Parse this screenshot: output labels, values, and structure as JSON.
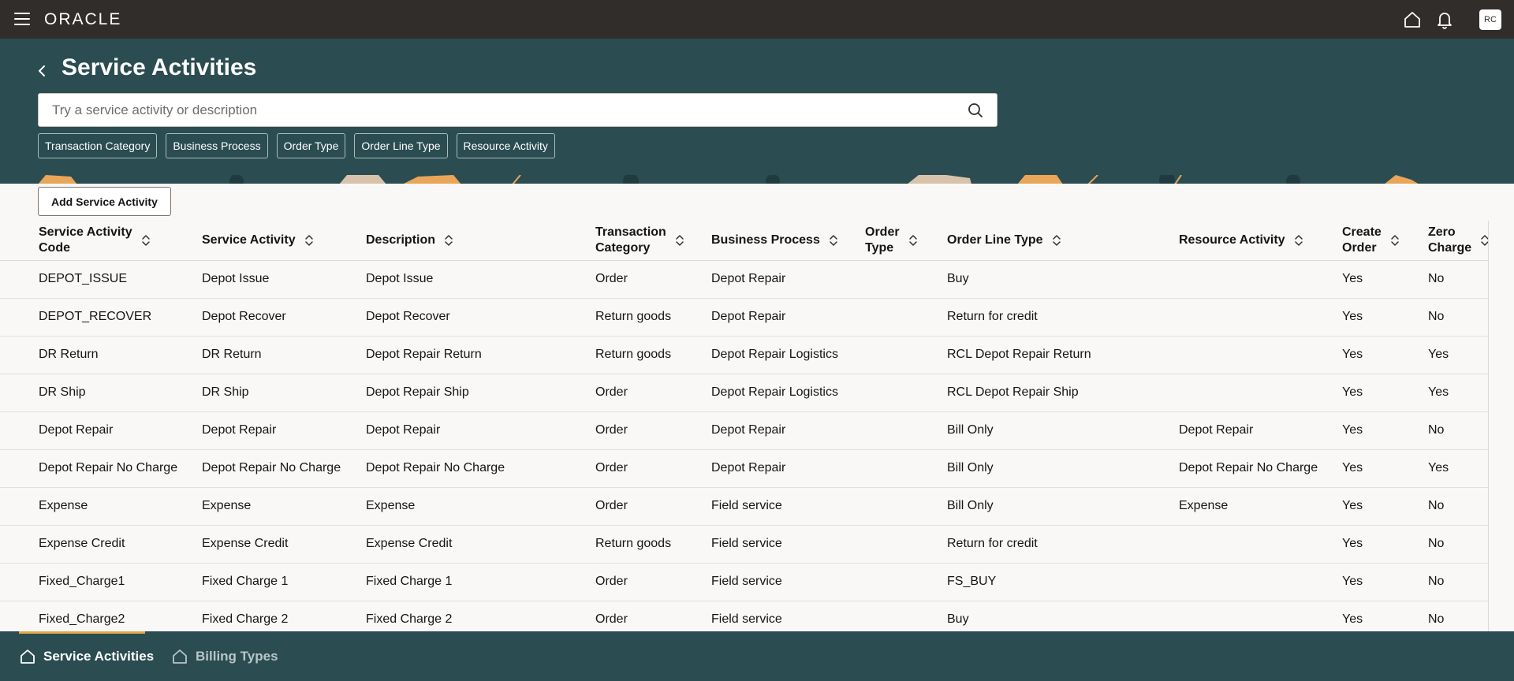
{
  "app": {
    "logo": "ORACLE",
    "avatar_initials": "RC"
  },
  "page": {
    "title": "Service Activities"
  },
  "search": {
    "placeholder": "Try a service activity or description"
  },
  "filters": [
    "Transaction Category",
    "Business Process",
    "Order Type",
    "Order Line Type",
    "Resource Activity"
  ],
  "toolbar": {
    "add_label": "Add Service Activity"
  },
  "table": {
    "columns": [
      [
        "Service Activity",
        "Code"
      ],
      [
        "Service Activity"
      ],
      [
        "Description"
      ],
      [
        "Transaction",
        "Category"
      ],
      [
        "Business Process"
      ],
      [
        "Order",
        "Type"
      ],
      [
        "Order Line Type"
      ],
      [
        "Resource Activity"
      ],
      [
        "Create",
        "Order"
      ],
      [
        "Zero",
        "Charge"
      ]
    ],
    "rows": [
      [
        "DEPOT_ISSUE",
        "Depot Issue",
        "Depot Issue",
        "Order",
        "Depot Repair",
        "",
        "Buy",
        "",
        "Yes",
        "No"
      ],
      [
        "DEPOT_RECOVER",
        "Depot Recover",
        "Depot Recover",
        "Return goods",
        "Depot Repair",
        "",
        "Return for credit",
        "",
        "Yes",
        "No"
      ],
      [
        "DR Return",
        "DR Return",
        "Depot Repair Return",
        "Return goods",
        "Depot Repair Logistics",
        "",
        "RCL Depot Repair Return",
        "",
        "Yes",
        "Yes"
      ],
      [
        "DR Ship",
        "DR Ship",
        "Depot Repair Ship",
        "Order",
        "Depot Repair Logistics",
        "",
        "RCL Depot Repair Ship",
        "",
        "Yes",
        "Yes"
      ],
      [
        "Depot Repair",
        "Depot Repair",
        "Depot Repair",
        "Order",
        "Depot Repair",
        "",
        "Bill Only",
        "Depot Repair",
        "Yes",
        "No"
      ],
      [
        "Depot Repair No Charge",
        "Depot Repair No Charge",
        "Depot Repair No Charge",
        "Order",
        "Depot Repair",
        "",
        "Bill Only",
        "Depot Repair No Charge",
        "Yes",
        "Yes"
      ],
      [
        "Expense",
        "Expense",
        "Expense",
        "Order",
        "Field service",
        "",
        "Bill Only",
        "Expense",
        "Yes",
        "No"
      ],
      [
        "Expense Credit",
        "Expense Credit",
        "Expense Credit",
        "Return goods",
        "Field service",
        "",
        "Return for credit",
        "",
        "Yes",
        "No"
      ],
      [
        "Fixed_Charge1",
        "Fixed Charge 1",
        "Fixed Charge 1",
        "Order",
        "Field service",
        "",
        "FS_BUY",
        "",
        "Yes",
        "No"
      ],
      [
        "Fixed_Charge2",
        "Fixed Charge 2",
        "Fixed Charge 2",
        "Order",
        "Field service",
        "",
        "Buy",
        "",
        "Yes",
        "No"
      ]
    ]
  },
  "bottom_tabs": [
    {
      "label": "Service Activities",
      "active": true,
      "icon": "home-icon"
    },
    {
      "label": "Billing Types",
      "active": false,
      "icon": "home-icon"
    }
  ],
  "colors": {
    "topbar": "#312d2a",
    "header": "#2b4c51",
    "accent": "#e0a84a"
  }
}
